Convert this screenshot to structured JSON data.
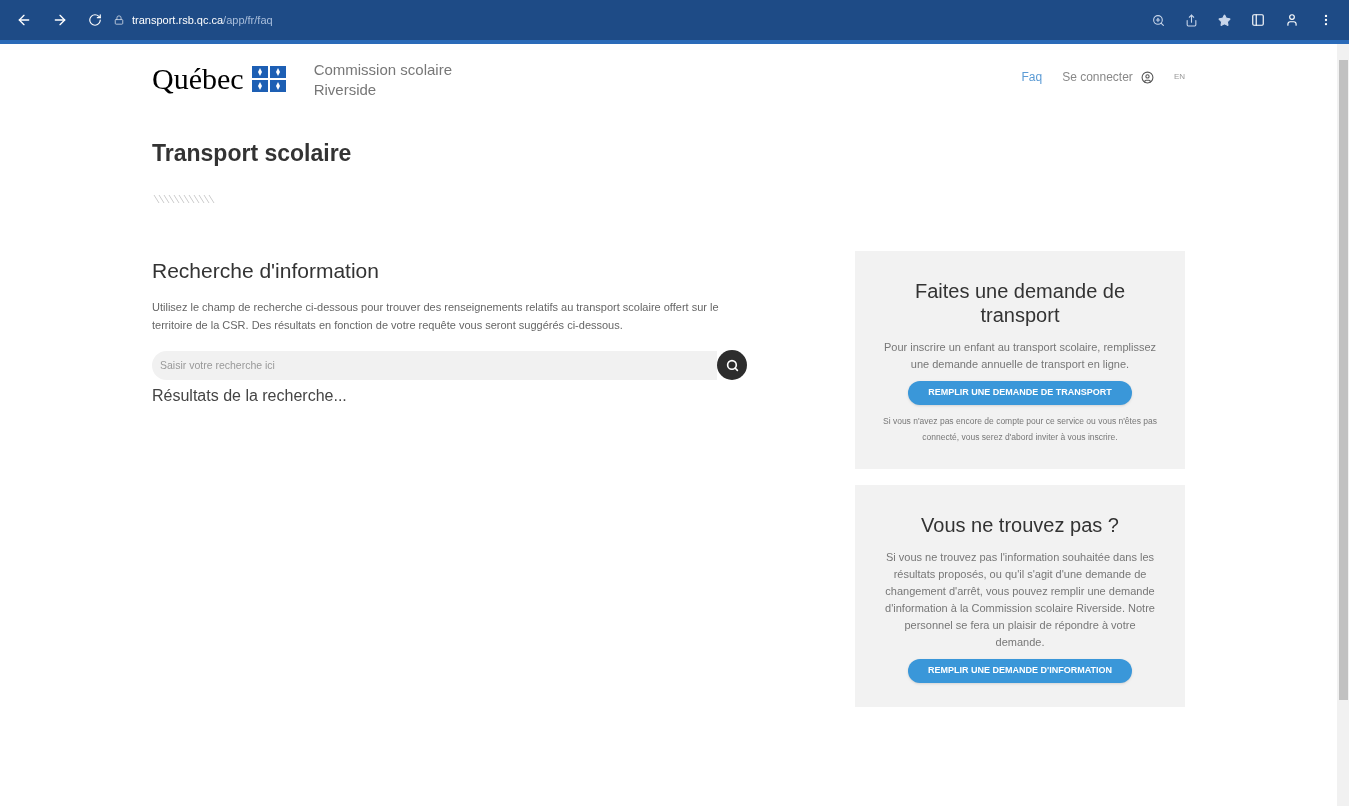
{
  "browser": {
    "url_host": "transport.rsb.qc.ca",
    "url_path": "/app/fr/faq"
  },
  "header": {
    "logo_text": "Québec",
    "org_lines": [
      "Commission scolaire",
      "Riverside"
    ],
    "nav": [
      {
        "label": "Faq",
        "selected": true
      },
      {
        "label": "Se connecter",
        "selected": false
      }
    ],
    "language": "EN"
  },
  "page_title": "Transport scolaire",
  "search_section": {
    "title": "Recherche d'information",
    "description": "Utilisez le champ de recherche ci-dessous pour trouver des renseignements relatifs au transport scolaire offert sur le territoire de la CSR. Des résultats en fonction de votre requête vous seront suggérés ci-dessous.",
    "placeholder": "Saisir votre recherche ici",
    "results_label": "Résultats de la recherche..."
  },
  "cards": [
    {
      "title": "Faites une demande de transport",
      "text": "Pour inscrire un enfant au transport scolaire, remplissez une demande annuelle de transport en ligne.",
      "button": "REMPLIR UNE DEMANDE DE TRANSPORT",
      "note": "Si vous n'avez pas encore de compte pour ce service ou vous n'êtes pas connecté, vous serez d'abord inviter à vous inscrire."
    },
    {
      "title": "Vous ne trouvez pas ?",
      "text": "Si vous ne trouvez pas l'information souhaitée dans les résultats proposés, ou qu'il s'agit d'une demande de changement d'arrêt, vous pouvez remplir une demande d'information à la Commission scolaire Riverside. Notre personnel se fera un plaisir de répondre à votre demande.",
      "button": "REMPLIR UNE DEMANDE D'INFORMATION"
    }
  ]
}
